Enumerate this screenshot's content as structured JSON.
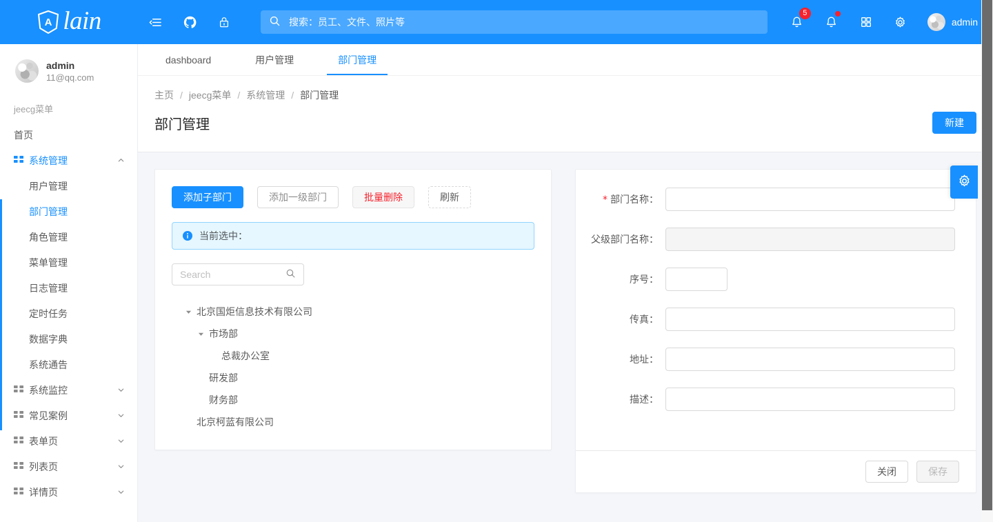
{
  "header": {
    "logo_text": "lain",
    "logo_icon": "angular-shield-icon",
    "menu_fold_icon": "menu-fold-icon",
    "github_icon": "github-icon",
    "lock_icon": "lock-icon",
    "search_icon": "search-icon",
    "search_placeholder": "搜索：员工、文件、照片等",
    "search_value": "",
    "bell_badge": "5",
    "bell_icon": "bell-icon",
    "notice_icon": "bell-icon",
    "apps_icon": "grid-apps-icon",
    "settings_icon": "gear-icon",
    "avatar_icon": "avatar",
    "user_name": "admin"
  },
  "sidebar": {
    "user": {
      "name": "admin",
      "email": "11@qq.com"
    },
    "group_title": "jeecg菜单",
    "home_label": "首页",
    "items": [
      {
        "label": "系统管理",
        "icon": "appstore-icon",
        "expanded": true,
        "active": true
      },
      {
        "label": "系统监控",
        "icon": "appstore-icon",
        "expanded": false,
        "active": false
      },
      {
        "label": "常见案例",
        "icon": "appstore-icon",
        "expanded": false,
        "active": false
      },
      {
        "label": "表单页",
        "icon": "appstore-icon",
        "expanded": false,
        "active": false
      },
      {
        "label": "列表页",
        "icon": "appstore-icon",
        "expanded": false,
        "active": false
      },
      {
        "label": "详情页",
        "icon": "appstore-icon",
        "expanded": false,
        "active": false
      }
    ],
    "subitems": [
      {
        "label": "用户管理",
        "active": false
      },
      {
        "label": "部门管理",
        "active": true
      },
      {
        "label": "角色管理",
        "active": false
      },
      {
        "label": "菜单管理",
        "active": false
      },
      {
        "label": "日志管理",
        "active": false
      },
      {
        "label": "定时任务",
        "active": false
      },
      {
        "label": "数据字典",
        "active": false
      },
      {
        "label": "系统通告",
        "active": false
      }
    ]
  },
  "tabs": [
    {
      "label": "dashboard",
      "active": false
    },
    {
      "label": "用户管理",
      "active": false
    },
    {
      "label": "部门管理",
      "active": true
    }
  ],
  "breadcrumb": [
    "主页",
    "jeecg菜单",
    "系统管理",
    "部门管理"
  ],
  "page": {
    "title": "部门管理",
    "new_button": "新建"
  },
  "left_panel": {
    "buttons": [
      {
        "label": "添加子部门",
        "style": "primary"
      },
      {
        "label": "添加一级部门",
        "style": "default"
      },
      {
        "label": "批量删除",
        "style": "danger"
      },
      {
        "label": "刷新",
        "style": "dashed"
      }
    ],
    "alert": {
      "icon": "info-circle-icon",
      "text": "当前选中："
    },
    "search": {
      "placeholder": "Search",
      "value": "",
      "icon": "search-icon"
    },
    "tree": [
      {
        "label": "北京国炬信息技术有限公司",
        "level": 0,
        "toggle": "caret-down-icon"
      },
      {
        "label": "市场部",
        "level": 1,
        "toggle": "caret-down-icon"
      },
      {
        "label": "总裁办公室",
        "level": 2,
        "toggle": ""
      },
      {
        "label": "研发部",
        "level": 1,
        "toggle": ""
      },
      {
        "label": "财务部",
        "level": 1,
        "toggle": ""
      },
      {
        "label": "北京柯蓝有限公司",
        "level": 0,
        "toggle": ""
      }
    ]
  },
  "form": {
    "fields": [
      {
        "label": "部门名称：",
        "required": true,
        "value": "",
        "size": "full",
        "disabled": false
      },
      {
        "label": "父级部门名称：",
        "required": false,
        "value": "",
        "size": "full",
        "disabled": true
      },
      {
        "label": "序号：",
        "required": false,
        "value": "",
        "size": "small",
        "disabled": false
      },
      {
        "label": "传真：",
        "required": false,
        "value": "",
        "size": "full",
        "disabled": false
      },
      {
        "label": "地址：",
        "required": false,
        "value": "",
        "size": "full",
        "disabled": false
      },
      {
        "label": "描述：",
        "required": false,
        "value": "",
        "size": "full",
        "disabled": false
      }
    ],
    "close_button": "关闭",
    "save_button": "保存"
  },
  "floating": {
    "settings_icon": "gear-icon"
  },
  "colors": {
    "primary": "#1890ff",
    "danger": "#f5222d",
    "content_bg": "#f5f6fa",
    "alert_bg": "#e6f7ff",
    "alert_border": "#91d5ff"
  }
}
